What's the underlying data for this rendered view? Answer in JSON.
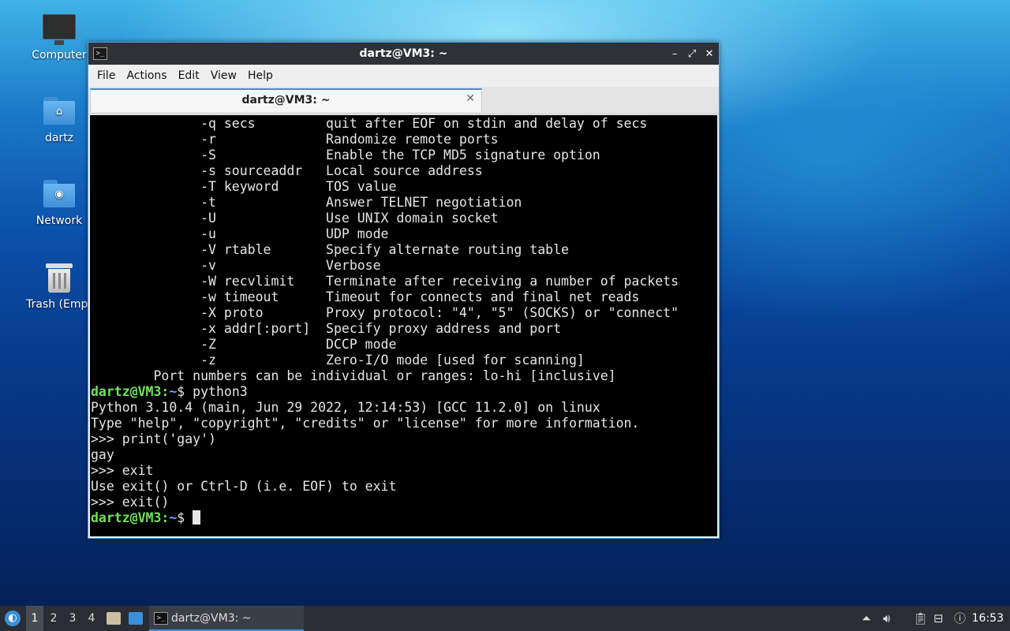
{
  "desktop": {
    "icons": [
      {
        "label": "Computer"
      },
      {
        "label": "dartz"
      },
      {
        "label": "Network"
      },
      {
        "label": "Trash (Empt"
      }
    ]
  },
  "window": {
    "title": "dartz@VM3: ~",
    "app_icon": ">_",
    "controls": {
      "minimize": "–",
      "maximize": "⤢",
      "close": "✕"
    },
    "menu": [
      "File",
      "Actions",
      "Edit",
      "View",
      "Help"
    ],
    "tab": {
      "title": "dartz@VM3: ~",
      "close": "✕"
    }
  },
  "terminal": {
    "lines": [
      {
        "text": "              -q secs         quit after EOF on stdin and delay of secs"
      },
      {
        "text": "              -r              Randomize remote ports"
      },
      {
        "text": "              -S              Enable the TCP MD5 signature option"
      },
      {
        "text": "              -s sourceaddr   Local source address"
      },
      {
        "text": "              -T keyword      TOS value"
      },
      {
        "text": "              -t              Answer TELNET negotiation"
      },
      {
        "text": "              -U              Use UNIX domain socket"
      },
      {
        "text": "              -u              UDP mode"
      },
      {
        "text": "              -V rtable       Specify alternate routing table"
      },
      {
        "text": "              -v              Verbose"
      },
      {
        "text": "              -W recvlimit    Terminate after receiving a number of packets"
      },
      {
        "text": "              -w timeout      Timeout for connects and final net reads"
      },
      {
        "text": "              -X proto        Proxy protocol: \"4\", \"5\" (SOCKS) or \"connect\""
      },
      {
        "text": "              -x addr[:port]  Specify proxy address and port"
      },
      {
        "text": "              -Z              DCCP mode"
      },
      {
        "text": "              -z              Zero-I/O mode [used for scanning]"
      },
      {
        "text": "        Port numbers can be individual or ranges: lo-hi [inclusive]"
      },
      {
        "user": "dartz@VM3",
        "path": "~",
        "cmd": " python3"
      },
      {
        "text": "Python 3.10.4 (main, Jun 29 2022, 12:14:53) [GCC 11.2.0] on linux"
      },
      {
        "text": "Type \"help\", \"copyright\", \"credits\" or \"license\" for more information."
      },
      {
        "text": ">>> print('gay')"
      },
      {
        "text": "gay"
      },
      {
        "text": ">>> exit"
      },
      {
        "text": "Use exit() or Ctrl-D (i.e. EOF) to exit"
      },
      {
        "text": ">>> exit()"
      },
      {
        "user": "dartz@VM3",
        "path": "~",
        "cmd": " ",
        "cursor": true
      }
    ],
    "colors": {
      "background": "#000000",
      "text": "#e6e6e6",
      "user": "#6fe35a",
      "path": "#6aa8ff"
    }
  },
  "taskbar": {
    "workspaces": [
      "1",
      "2",
      "3",
      "4"
    ],
    "active_workspace": "1",
    "task_label": "dartz@VM3: ~",
    "clock": "16:53"
  }
}
